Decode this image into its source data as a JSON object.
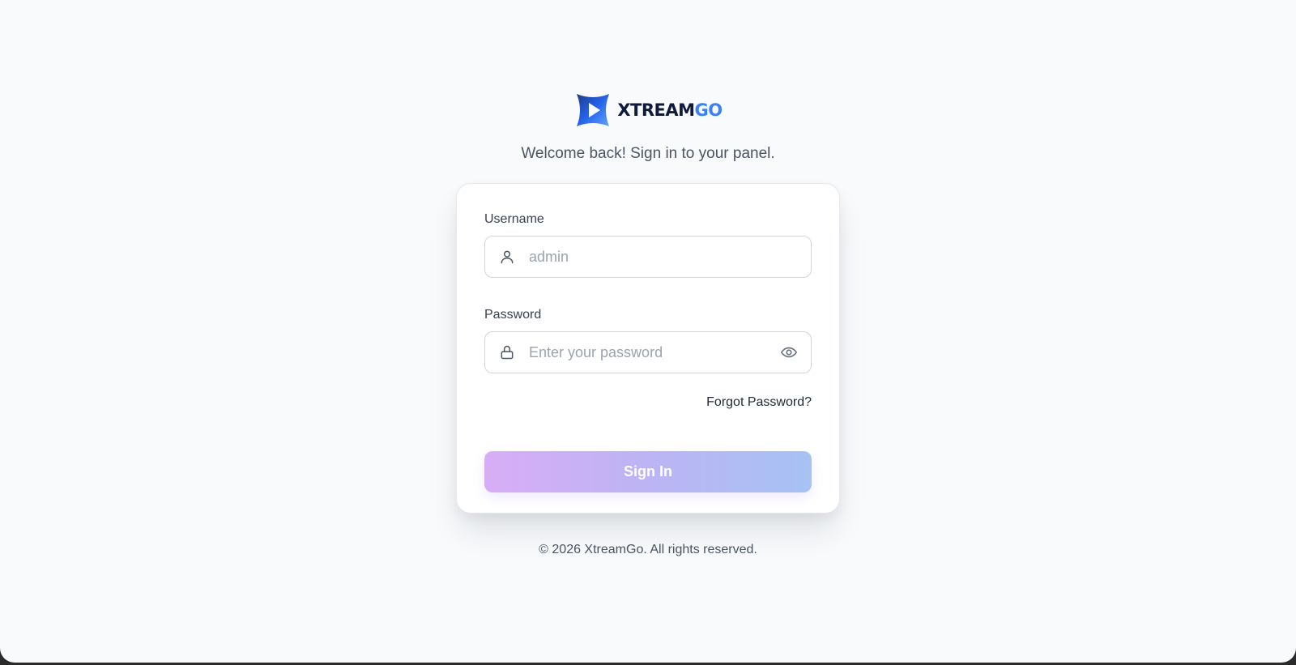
{
  "brand": {
    "logo_alt": "XtreamGo",
    "name_part1": "XTREAM",
    "name_part2": "GO",
    "colors": {
      "dark": "#111a3a",
      "accent": "#3b82f6"
    }
  },
  "subtitle": "Welcome back! Sign in to your panel.",
  "form": {
    "username": {
      "label": "Username",
      "placeholder": "admin",
      "value": "",
      "icon": "user-icon"
    },
    "password": {
      "label": "Password",
      "placeholder": "Enter your password",
      "value": "",
      "icon": "lock-icon",
      "toggle_icon": "eye-icon"
    },
    "forgot_label": "Forgot Password?",
    "submit_label": "Sign In"
  },
  "footer": "© 2026 XtreamGo. All rights reserved."
}
